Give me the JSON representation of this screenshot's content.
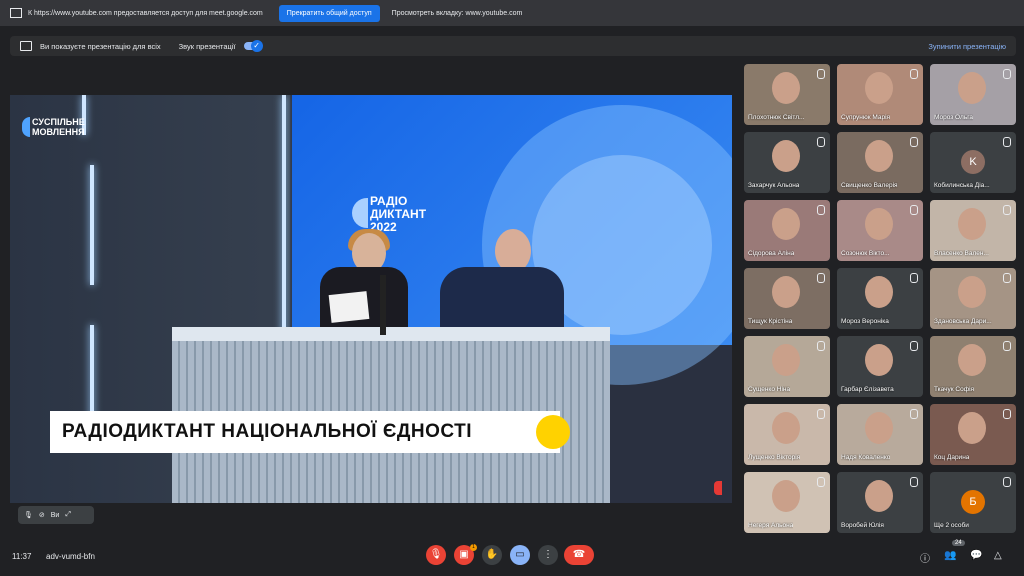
{
  "share_bar": {
    "message": "К https://www.youtube.com предоставляется доступ для meet.google.com",
    "stop_label": "Прекратить общий доступ",
    "view_label": "Просмотреть вкладку: www.youtube.com"
  },
  "presentation_bar": {
    "presenting_text": "Ви показуєте презентацію для всіх",
    "audio_label": "Звук презентації",
    "stop_label": "Зупинити презентацію"
  },
  "stage": {
    "brand_line1": "СУСПІЛЬНЕ",
    "brand_line2": "МОВЛЕННЯ",
    "screen_line1": "РАДІО",
    "screen_line2": "ДИКТАНТ",
    "screen_line3": "2022",
    "banner": "РАДІОДИКТАНТ НАЦІОНАЛЬНОЇ ЄДНОСТІ",
    "self_label": "Ви"
  },
  "participants": [
    {
      "name": "Плохотнюк Світл..."
    },
    {
      "name": "Супрунюк Марія"
    },
    {
      "name": "Мороз Ольга"
    },
    {
      "name": "Захарчук Альона"
    },
    {
      "name": "Свищенко Валерія"
    },
    {
      "name": "Кобилинська Діа...",
      "initial": "K"
    },
    {
      "name": "Сідорова Аліна"
    },
    {
      "name": "Созонюк Вікто..."
    },
    {
      "name": "Власенко Вален..."
    },
    {
      "name": "Тищук Крістіна"
    },
    {
      "name": "Мороз Вероніка"
    },
    {
      "name": "Здановська Дари..."
    },
    {
      "name": "Сущенко Ніна"
    },
    {
      "name": "Гарбар Єлізавета"
    },
    {
      "name": "Ткачук Софія"
    },
    {
      "name": "Лущенко Вікторія"
    },
    {
      "name": "Надя Коваленко"
    },
    {
      "name": "Коц Дарина"
    },
    {
      "name": "Негеря Альона"
    },
    {
      "name": "Воробей Юлія"
    },
    {
      "name": "Ще 2 особи",
      "initial": "Б"
    }
  ],
  "bottom": {
    "time": "11:37",
    "meeting_code": "adv-vumd-bfn",
    "people_count": "24",
    "reaction_badge": "1"
  },
  "colors": {
    "accent": "#1a73e8",
    "hangup": "#ea4335",
    "banner_yellow": "#ffd200"
  }
}
